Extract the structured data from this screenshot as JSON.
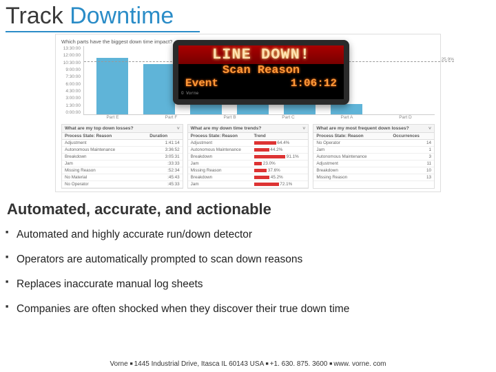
{
  "title_part1": "Track ",
  "title_part2": "Downtime",
  "dashboard": {
    "chart_title": "Which parts have the biggest down time impact?",
    "ref_label": "25.9%",
    "led": {
      "top": "LINE DOWN!",
      "mid": "Scan Reason",
      "bot_left": "Event",
      "bot_right": "1:06:12",
      "foot": "© Vorne"
    },
    "panel1": {
      "q": "What are my top down losses?",
      "cols": [
        "Process State: Reason",
        "Duration"
      ],
      "rows": [
        [
          "Adjustment",
          "1:41:14"
        ],
        [
          "Autonomous Maintenance",
          "3:36:52"
        ],
        [
          "Breakdown",
          "3:05:31"
        ],
        [
          "Jam",
          ":33:33"
        ],
        [
          "Missing Reason",
          ":52:34"
        ],
        [
          "No Material",
          ":45:43"
        ],
        [
          "No Operator",
          ":45:33"
        ]
      ]
    },
    "panel2": {
      "q": "What are my down time trends?",
      "cols": [
        "Process State: Reason",
        "Trend"
      ],
      "rows": [
        [
          "Adjustment",
          64,
          "64.4%"
        ],
        [
          "Autonomous Maintenance",
          44,
          "44.2%"
        ],
        [
          "Breakdown",
          91,
          "91.1%"
        ],
        [
          "Jam",
          23,
          "23.0%"
        ],
        [
          "Missing Reason",
          37,
          "37.6%"
        ],
        [
          "Breakdown",
          45,
          "45.2%"
        ],
        [
          "Jam",
          72,
          "72.1%"
        ]
      ]
    },
    "panel3": {
      "q": "What are my most frequent down losses?",
      "cols": [
        "Process State: Reason",
        "Occurrences"
      ],
      "rows": [
        [
          "No Operator",
          "14"
        ],
        [
          "Jam",
          "1"
        ],
        [
          "Autonomous Maintenance",
          "3"
        ],
        [
          "Adjustment",
          "11"
        ],
        [
          "Breakdown",
          "10"
        ],
        [
          "Missing Reason",
          "13"
        ]
      ]
    }
  },
  "chart_data": {
    "type": "bar",
    "title": "Which parts have the biggest down time impact?",
    "categories": [
      "Part E",
      "Part F",
      "Part B",
      "Part C",
      "Part A",
      "Part D"
    ],
    "values": [
      11.2,
      10.0,
      9.3,
      8.8,
      8.2,
      2.1
    ],
    "yticks": [
      "0:00:00",
      "1:30:00",
      "3:00:00",
      "4:30:00",
      "6:00:00",
      "7:30:00",
      "9:00:00",
      "10:30:00",
      "12:00:00",
      "13:30:00"
    ],
    "ylabel": "",
    "xlabel": "",
    "reference_line": {
      "label": "25.9%",
      "y_fraction": 0.78
    }
  },
  "subtitle": "Automated, accurate, and actionable",
  "bullets": [
    "Automated and highly accurate run/down detector",
    "Operators are automatically prompted to scan down reasons",
    "Replaces inaccurate manual log sheets",
    "Companies are often shocked when they discover their true down time"
  ],
  "footer": {
    "company": "Vorne",
    "address": "1445 Industrial Drive, Itasca IL 60143 USA",
    "phone": "+1. 630. 875. 3600",
    "url": "www. vorne. com"
  }
}
